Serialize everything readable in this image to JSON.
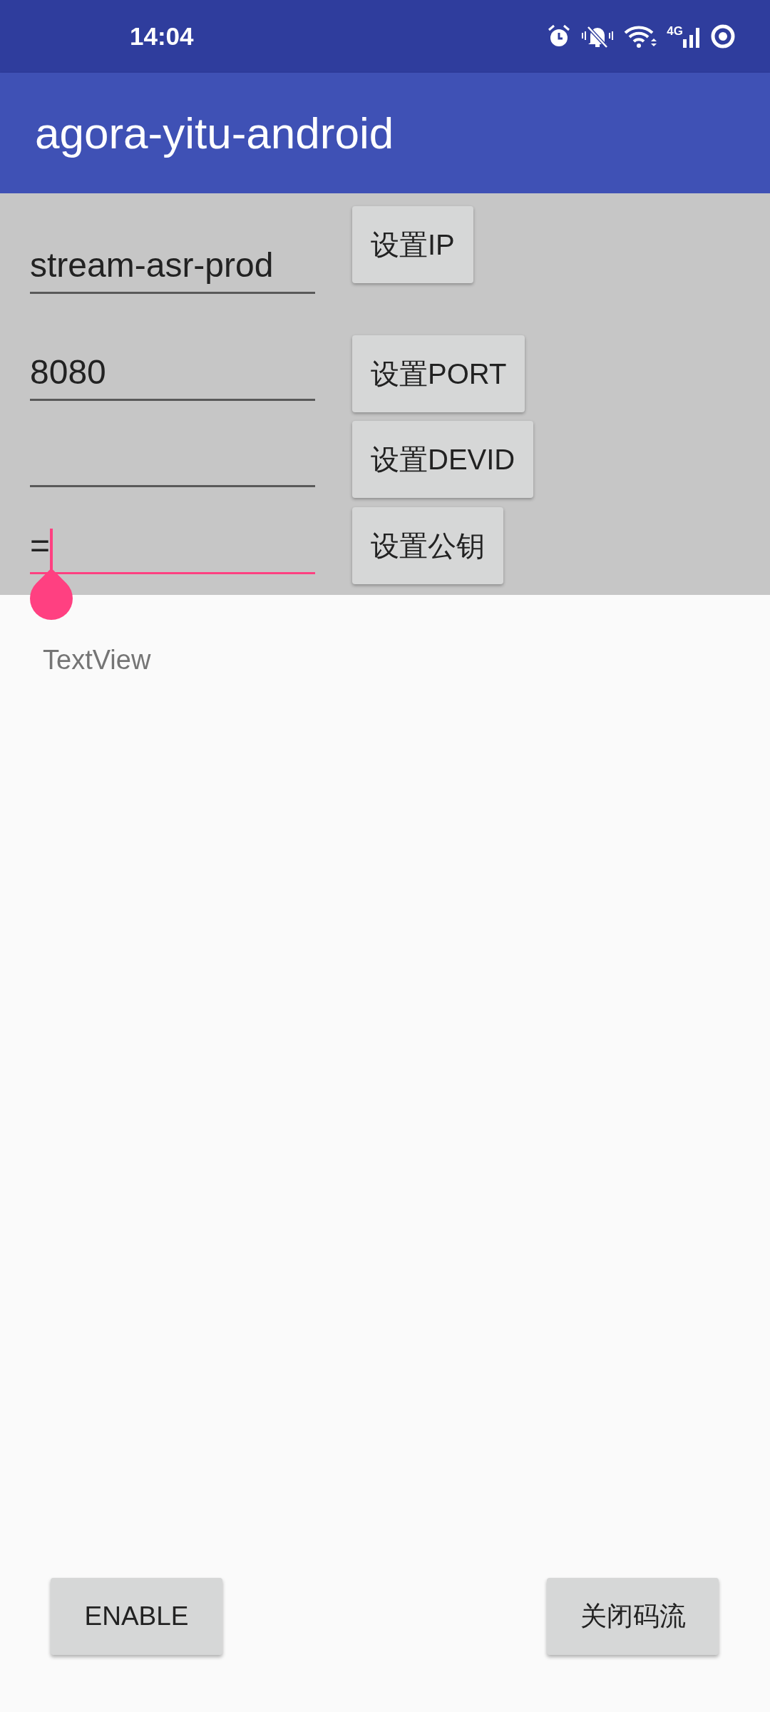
{
  "status_bar": {
    "time": "14:04",
    "network": "4G"
  },
  "app_bar": {
    "title": "agora-yitu-android"
  },
  "form": [
    {
      "value": "stream-asr-prod",
      "focused": false,
      "button": "设置IP"
    },
    {
      "value": "8080",
      "focused": false,
      "button": "设置PORT"
    },
    {
      "focused": false,
      "button": "设置DEVID"
    },
    {
      "value": "=",
      "focused": true,
      "button": "设置公钥"
    }
  ],
  "text_view": "TextView",
  "bottom_buttons": [
    "ENABLE",
    "关闭码流"
  ]
}
